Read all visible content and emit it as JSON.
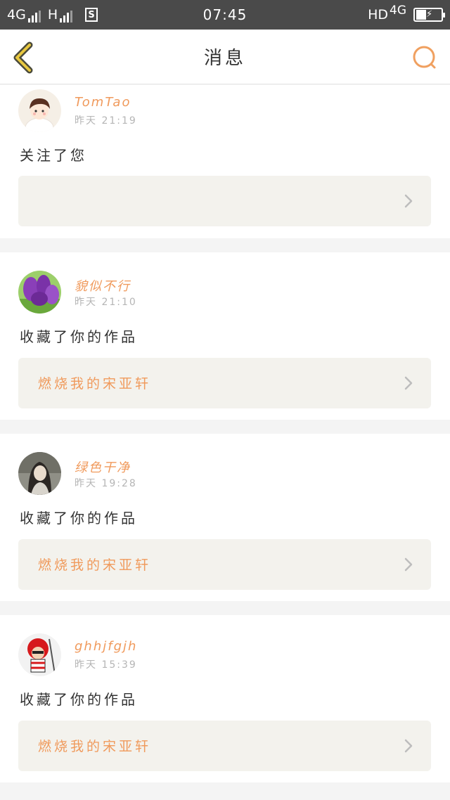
{
  "status_bar": {
    "left_network_1": "4G",
    "left_network_2": "H",
    "sim_label": "S",
    "time": "07:45",
    "hd_label": "HD",
    "right_network": "4G"
  },
  "nav": {
    "title": "消息",
    "back_icon": "chevron-left-icon",
    "search_icon": "search-icon",
    "accent_color": "#f0a060",
    "back_color": "#e8b830"
  },
  "messages": [
    {
      "user": "TomTao",
      "time": "昨天 21:19",
      "action": "关注了您",
      "work_title": "",
      "avatar": "cartoon-boy-avatar"
    },
    {
      "user": "貌似不行",
      "time": "昨天 21:10",
      "action": "收藏了你的作品",
      "work_title": "燃烧我的宋亚轩",
      "avatar": "purple-tulips-avatar"
    },
    {
      "user": "绿色干净",
      "time": "昨天 19:28",
      "action": "收藏了你的作品",
      "work_title": "燃烧我的宋亚轩",
      "avatar": "girl-photo-avatar"
    },
    {
      "user": "ghhjfgjh",
      "time": "昨天 15:39",
      "action": "收藏了你的作品",
      "work_title": "燃烧我的宋亚轩",
      "avatar": "red-hat-figure-avatar"
    }
  ],
  "colors": {
    "username": "#f09a5c",
    "work_box_bg": "#f3f2ed",
    "page_bg": "#f4f4f4"
  }
}
